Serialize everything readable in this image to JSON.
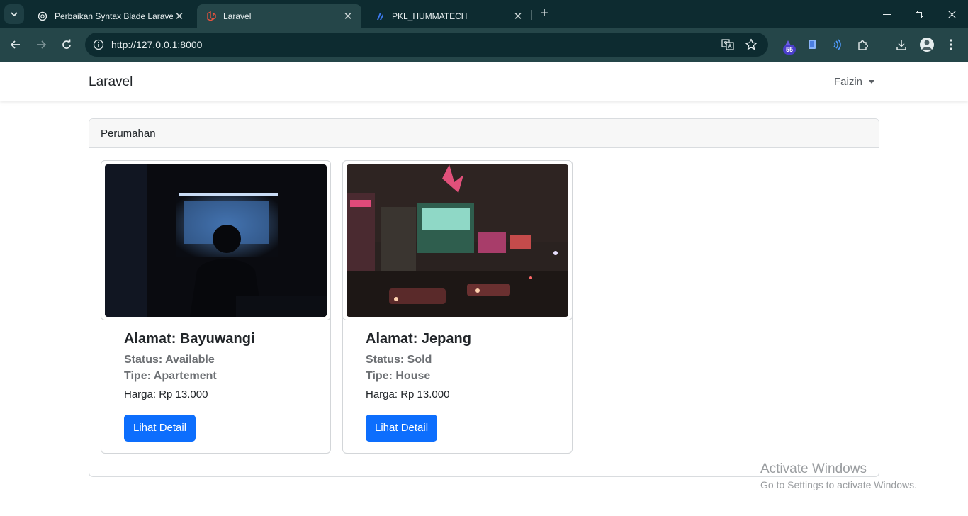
{
  "browser": {
    "tabs": [
      {
        "title": "Perbaikan Syntax Blade Laravel",
        "icon": "openai-icon",
        "active": false
      },
      {
        "title": "Laravel",
        "icon": "laravel-icon",
        "active": true
      },
      {
        "title": "PKL_HUMMATECH",
        "icon": "app-icon",
        "active": false
      }
    ],
    "url": "http://127.0.0.1:8000",
    "extension_badge": "55"
  },
  "navbar": {
    "brand": "Laravel",
    "user": "Faizin"
  },
  "panel": {
    "header": "Perumahan",
    "cards": [
      {
        "title": "Alamat: Bayuwangi",
        "status": "Status: Available",
        "type": "Tipe: Apartement",
        "price": "Harga: Rp 13.000",
        "button": "Lihat Detail",
        "image": "dark-room-projector-photo"
      },
      {
        "title": "Alamat: Jepang",
        "status": "Status: Sold",
        "type": "Tipe: House",
        "price": "Harga: Rp 13.000",
        "button": "Lihat Detail",
        "image": "neon-street-movieland-photo"
      }
    ]
  },
  "watermark": {
    "line1": "Activate Windows",
    "line2": "Go to Settings to activate Windows."
  },
  "colors": {
    "chrome_dark": "#0d2b30",
    "chrome_mid": "#254649",
    "primary_button": "#0d6efd"
  }
}
